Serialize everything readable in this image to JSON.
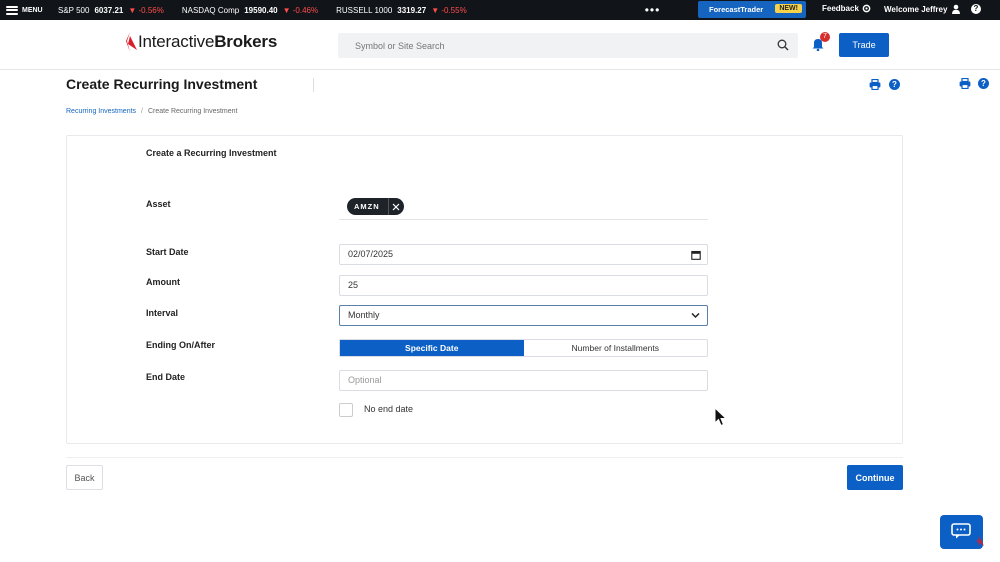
{
  "ticker": {
    "menu_label": "MENU",
    "items": [
      {
        "symbol": "S&P 500",
        "value": "6037.21",
        "change": "▼ -0.56%"
      },
      {
        "symbol": "NASDAQ Comp",
        "value": "19590.40",
        "change": "▼ -0.46%"
      },
      {
        "symbol": "RUSSELL 1000",
        "value": "3319.27",
        "change": "▼ -0.55%"
      }
    ],
    "more": "•••",
    "forecast_label": "ForecastTrader",
    "forecast_badge": "NEW!",
    "feedback_label": "Feedback",
    "welcome_label": "Welcome Jeffrey",
    "help_label": "?"
  },
  "header": {
    "logo_bold": "Interactive",
    "logo_regular": "Brokers",
    "search_placeholder": "Symbol or Site Search",
    "notification_count": "7",
    "trade_label": "Trade"
  },
  "page": {
    "title": "Create Recurring Investment",
    "help_label": "?",
    "breadcrumb": {
      "parent": "Recurring Investments",
      "separator": "/",
      "current": "Create Recurring Investment"
    }
  },
  "form": {
    "heading": "Create a Recurring Investment",
    "asset_label": "Asset",
    "asset_chip": "AMZN",
    "start_date_label": "Start Date",
    "start_date_value": "02/07/2025",
    "amount_label": "Amount",
    "amount_value": "25",
    "interval_label": "Interval",
    "interval_value": "Monthly",
    "ending_label": "Ending On/After",
    "ending_options": [
      "Specific Date",
      "Number of Installments"
    ],
    "ending_selected": "Specific Date",
    "end_date_label": "End Date",
    "end_date_placeholder": "Optional",
    "no_end_date_label": "No end date",
    "no_end_date_checked": false
  },
  "actions": {
    "back_label": "Back",
    "continue_label": "Continue"
  },
  "colors": {
    "primary": "#0b5fc5",
    "ticker_bg": "#111418",
    "negative": "#ff4d4d",
    "badge_yellow": "#f6d24a",
    "logo_red": "#d81e2c"
  }
}
